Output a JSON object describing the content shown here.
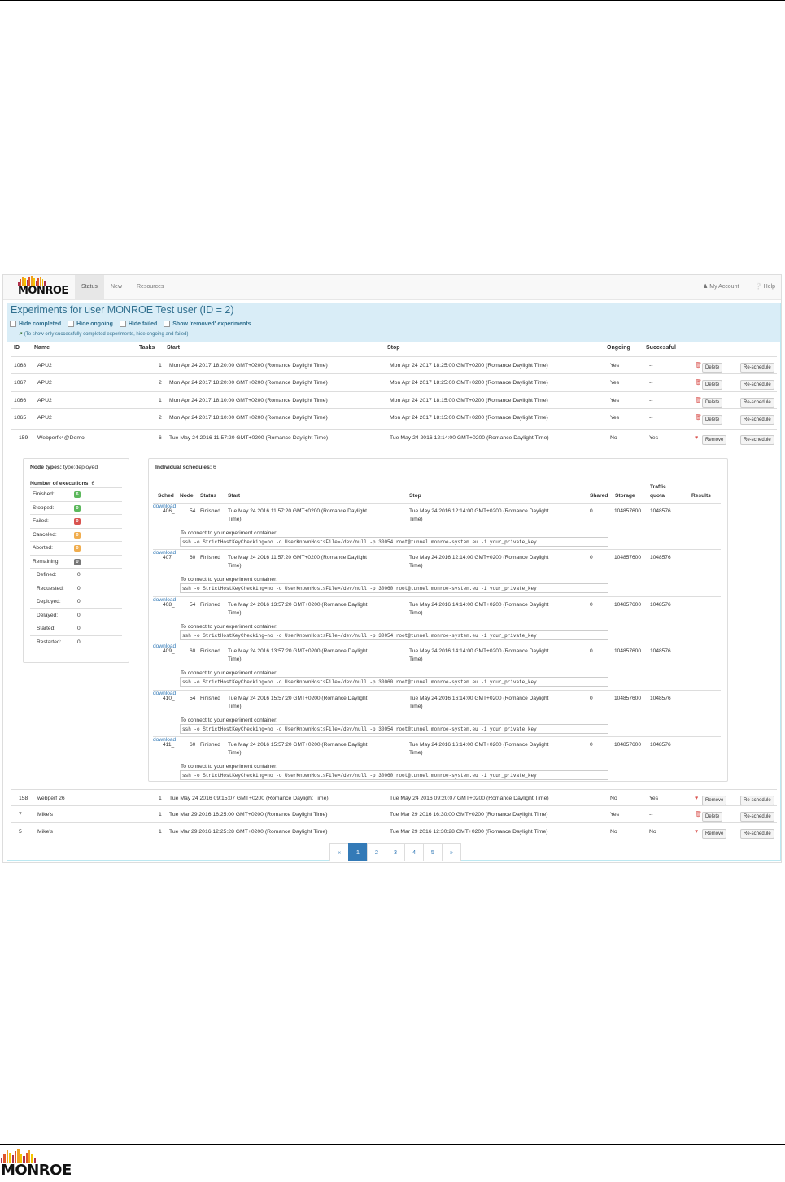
{
  "brand": {
    "name": "MONROE",
    "bar_colors": [
      "#b0324b",
      "#e0572b",
      "#f0a020",
      "#f5c400"
    ]
  },
  "nav": {
    "items": [
      {
        "label": "Status",
        "active": true
      },
      {
        "label": "New"
      },
      {
        "label": "Resources"
      }
    ],
    "account": "My Account",
    "help": "Help"
  },
  "panel": {
    "title": "Experiments for user MONROE Test user (ID = 2)",
    "filters": [
      "Hide completed",
      "Hide ongoing",
      "Hide failed",
      "Show 'removed' experiments"
    ],
    "note": "(To show only successfully completed experiments, hide ongoing and failed)"
  },
  "columns": {
    "id": "ID",
    "name": "Name",
    "tasks": "Tasks",
    "start": "Start",
    "stop": "Stop",
    "ongoing": "Ongoing",
    "successful": "Successful"
  },
  "experiments": [
    {
      "id": "1068",
      "name": "APU2",
      "tasks": "1",
      "start": "Mon Apr 24 2017 18:20:00 GMT+0200 (Romance Daylight Time)",
      "stop": "Mon Apr 24 2017 18:25:00 GMT+0200 (Romance Daylight Time)",
      "ongoing": "Yes",
      "successful": "--",
      "action": "Delete",
      "reschedule": "Re-schedule"
    },
    {
      "id": "1067",
      "name": "APU2",
      "tasks": "2",
      "start": "Mon Apr 24 2017 18:20:00 GMT+0200 (Romance Daylight Time)",
      "stop": "Mon Apr 24 2017 18:25:00 GMT+0200 (Romance Daylight Time)",
      "ongoing": "Yes",
      "successful": "--",
      "action": "Delete",
      "reschedule": "Re-schedule"
    },
    {
      "id": "1066",
      "name": "APU2",
      "tasks": "1",
      "start": "Mon Apr 24 2017 18:10:00 GMT+0200 (Romance Daylight Time)",
      "stop": "Mon Apr 24 2017 18:15:00 GMT+0200 (Romance Daylight Time)",
      "ongoing": "Yes",
      "successful": "--",
      "action": "Delete",
      "reschedule": "Re-schedule"
    },
    {
      "id": "1065",
      "name": "APU2",
      "tasks": "2",
      "start": "Mon Apr 24 2017 18:10:00 GMT+0200 (Romance Daylight Time)",
      "stop": "Mon Apr 24 2017 18:15:00 GMT+0200 (Romance Daylight Time)",
      "ongoing": "Yes",
      "successful": "--",
      "action": "Delete",
      "reschedule": "Re-schedule"
    },
    {
      "id": "159",
      "name": "Webperfx4@Demo",
      "tasks": "6",
      "start": "Tue May 24 2016 11:57:20 GMT+0200 (Romance Daylight Time)",
      "stop": "Tue May 24 2016 12:14:00 GMT+0200 (Romance Daylight Time)",
      "ongoing": "No",
      "successful": "Yes",
      "action": "Remove",
      "reschedule": "Re-schedule"
    },
    {
      "id": "158",
      "name": "webperf 26",
      "tasks": "1",
      "start": "Tue May 24 2016 09:15:07 GMT+0200 (Romance Daylight Time)",
      "stop": "Tue May 24 2016 09:20:07 GMT+0200 (Romance Daylight Time)",
      "ongoing": "No",
      "successful": "Yes",
      "action": "Remove",
      "reschedule": "Re-schedule"
    },
    {
      "id": "7",
      "name": "Mike's",
      "tasks": "1",
      "start": "Tue Mar 29 2016 16:25:00 GMT+0200 (Romance Daylight Time)",
      "stop": "Tue Mar 29 2016 16:30:00 GMT+0200 (Romance Daylight Time)",
      "ongoing": "Yes",
      "successful": "--",
      "action": "Delete",
      "reschedule": "Re-schedule"
    },
    {
      "id": "5",
      "name": "Mike's",
      "tasks": "1",
      "start": "Tue Mar 29 2016 12:25:28 GMT+0200 (Romance Daylight Time)",
      "stop": "Tue Mar 29 2016 12:30:28 GMT+0200 (Romance Daylight Time)",
      "ongoing": "No",
      "successful": "No",
      "action": "Remove",
      "reschedule": "Re-schedule"
    }
  ],
  "detail": {
    "node_types_label": "Node types:",
    "node_types_value": "type:deployed",
    "executions_label": "Number of executions:",
    "executions_value": "6",
    "status_counts": [
      {
        "label": "Finished:",
        "value": "6",
        "color": "#5cb85c"
      },
      {
        "label": "Stopped:",
        "value": "0",
        "color": "#5cb85c"
      },
      {
        "label": "Failed:",
        "value": "0",
        "color": "#d9534f"
      },
      {
        "label": "Canceled:",
        "value": "0",
        "color": "#f0ad4e"
      },
      {
        "label": "Aborted:",
        "value": "0",
        "color": "#f0ad4e"
      },
      {
        "label": "Remaining:",
        "value": "0",
        "color": "#777777"
      }
    ],
    "remaining_breakdown": [
      {
        "label": "Defined:",
        "value": "0"
      },
      {
        "label": "Requested:",
        "value": "0"
      },
      {
        "label": "Deployed:",
        "value": "0"
      },
      {
        "label": "Delayed:",
        "value": "0"
      },
      {
        "label": "Started:",
        "value": "0"
      },
      {
        "label": "Restarted:",
        "value": "0"
      }
    ],
    "schedules_label": "Individual schedules:",
    "schedules_value": "6",
    "sched_columns": {
      "sched": "Sched",
      "node": "Node",
      "status": "Status",
      "start": "Start",
      "stop": "Stop",
      "shared": "Shared",
      "storage": "Storage",
      "traffic_1": "Traffic",
      "traffic_2": "quota",
      "results": "Results"
    },
    "connect_label": "To connect to your experiment container:",
    "schedules": [
      {
        "sched": "406_",
        "node": "54",
        "status": "Finished",
        "start_1": "Tue May 24 2016 11:57:20 GMT+0200 (Romance Daylight",
        "start_2": "Time)",
        "stop_1": "Tue May 24 2016 12:14:00 GMT+0200 (Romance Daylight",
        "stop_2": "Time)",
        "shared": "0",
        "storage": "104857600",
        "traffic": "1048576",
        "results": "download",
        "ssh": "ssh -o StrictHostKeyChecking=no -o UserKnownHostsFile=/dev/null -p 30054 root@tunnel.monroe-system.eu -i your_private_key"
      },
      {
        "sched": "407_",
        "node": "60",
        "status": "Finished",
        "start_1": "Tue May 24 2016 11:57:20 GMT+0200 (Romance Daylight",
        "start_2": "Time)",
        "stop_1": "Tue May 24 2016 12:14:00 GMT+0200 (Romance Daylight",
        "stop_2": "Time)",
        "shared": "0",
        "storage": "104857600",
        "traffic": "1048576",
        "results": "download",
        "ssh": "ssh -o StrictHostKeyChecking=no -o UserKnownHostsFile=/dev/null -p 30060 root@tunnel.monroe-system.eu -i your_private_key"
      },
      {
        "sched": "408_",
        "node": "54",
        "status": "Finished",
        "start_1": "Tue May 24 2016 13:57:20 GMT+0200 (Romance Daylight",
        "start_2": "Time)",
        "stop_1": "Tue May 24 2016 14:14:00 GMT+0200 (Romance Daylight",
        "stop_2": "Time)",
        "shared": "0",
        "storage": "104857600",
        "traffic": "1048576",
        "results": "download",
        "ssh": "ssh -o StrictHostKeyChecking=no -o UserKnownHostsFile=/dev/null -p 30054 root@tunnel.monroe-system.eu -i your_private_key"
      },
      {
        "sched": "409_",
        "node": "60",
        "status": "Finished",
        "start_1": "Tue May 24 2016 13:57:20 GMT+0200 (Romance Daylight",
        "start_2": "Time)",
        "stop_1": "Tue May 24 2016 14:14:00 GMT+0200 (Romance Daylight",
        "stop_2": "Time)",
        "shared": "0",
        "storage": "104857600",
        "traffic": "1048576",
        "results": "download",
        "ssh": "ssh -o StrictHostKeyChecking=no -o UserKnownHostsFile=/dev/null -p 30060 root@tunnel.monroe-system.eu -i your_private_key"
      },
      {
        "sched": "410_",
        "node": "54",
        "status": "Finished",
        "start_1": "Tue May 24 2016 15:57:20 GMT+0200 (Romance Daylight",
        "start_2": "Time)",
        "stop_1": "Tue May 24 2016 16:14:00 GMT+0200 (Romance Daylight",
        "stop_2": "Time)",
        "shared": "0",
        "storage": "104857600",
        "traffic": "1048576",
        "results": "download",
        "ssh": "ssh -o StrictHostKeyChecking=no -o UserKnownHostsFile=/dev/null -p 30054 root@tunnel.monroe-system.eu -i your_private_key"
      },
      {
        "sched": "411_",
        "node": "60",
        "status": "Finished",
        "start_1": "Tue May 24 2016 15:57:20 GMT+0200 (Romance Daylight",
        "start_2": "Time)",
        "stop_1": "Tue May 24 2016 16:14:00 GMT+0200 (Romance Daylight",
        "stop_2": "Time)",
        "shared": "0",
        "storage": "104857600",
        "traffic": "1048576",
        "results": "download",
        "ssh": "ssh -o StrictHostKeyChecking=no -o UserKnownHostsFile=/dev/null -p 30060 root@tunnel.monroe-system.eu -i your_private_key"
      }
    ]
  },
  "pagination": {
    "prev": "«",
    "pages": [
      "1",
      "2",
      "3",
      "4",
      "5"
    ],
    "active": "1",
    "next": "»"
  }
}
